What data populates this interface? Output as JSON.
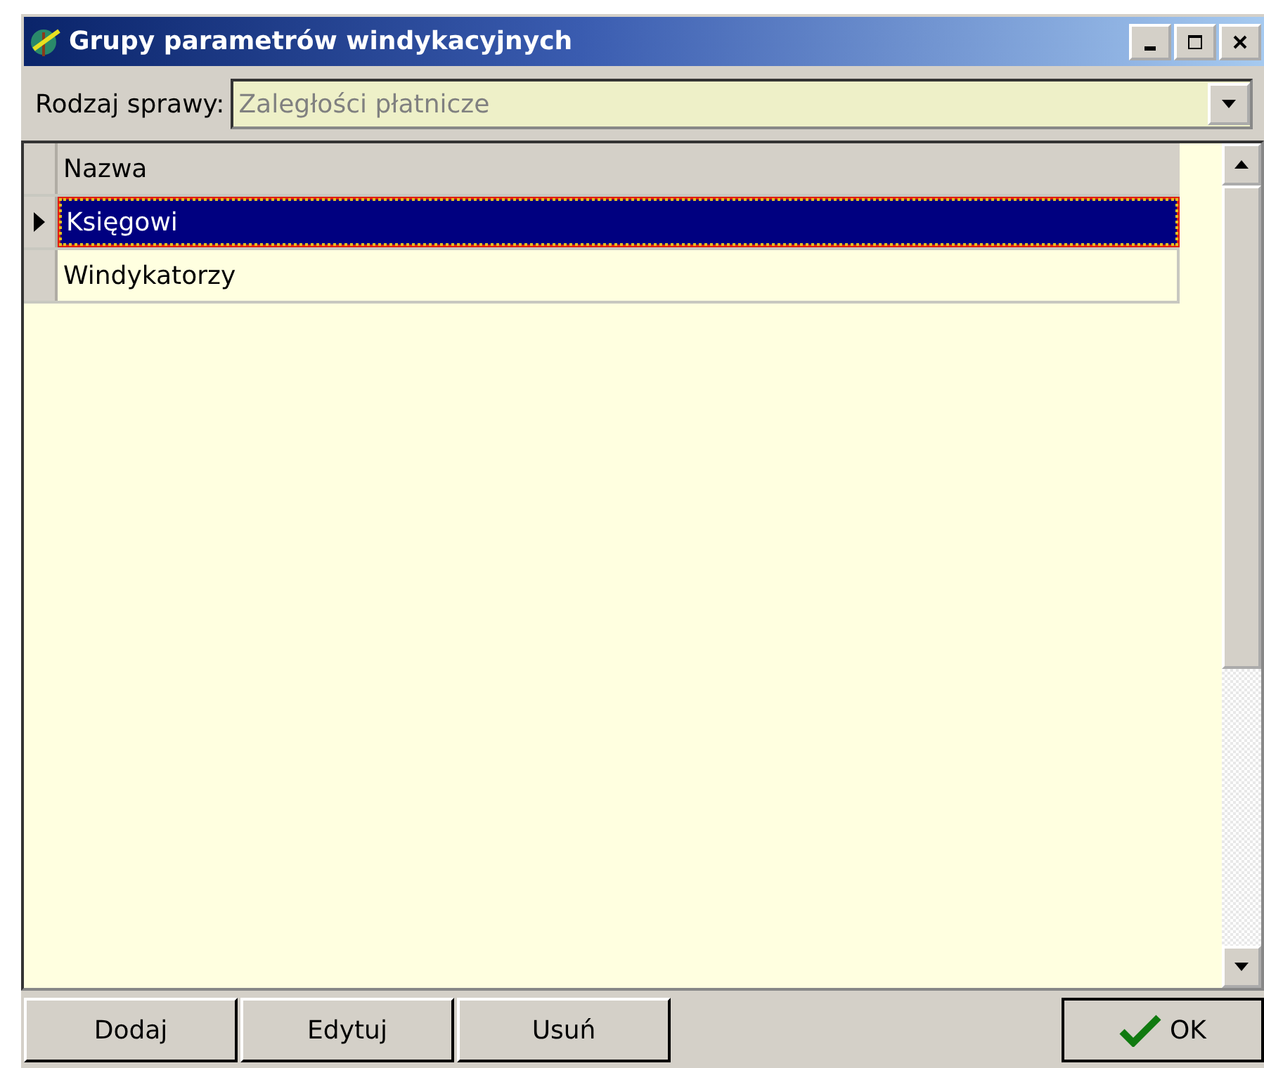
{
  "window": {
    "title": "Grupy parametrów windykacyjnych"
  },
  "filter": {
    "label": "Rodzaj sprawy:",
    "value": "Zaległości płatnicze",
    "disabled": true
  },
  "table": {
    "columns": [
      "Nazwa"
    ],
    "rows": [
      {
        "name": "Księgowi",
        "selected": true
      },
      {
        "name": "Windykatorzy",
        "selected": false
      }
    ]
  },
  "buttons": [
    {
      "label": "Dodaj",
      "kind": "plain"
    },
    {
      "label": "Edytuj",
      "kind": "plain"
    },
    {
      "label": "Usuń",
      "kind": "plain"
    },
    {
      "label": "OK",
      "kind": "ok"
    }
  ]
}
